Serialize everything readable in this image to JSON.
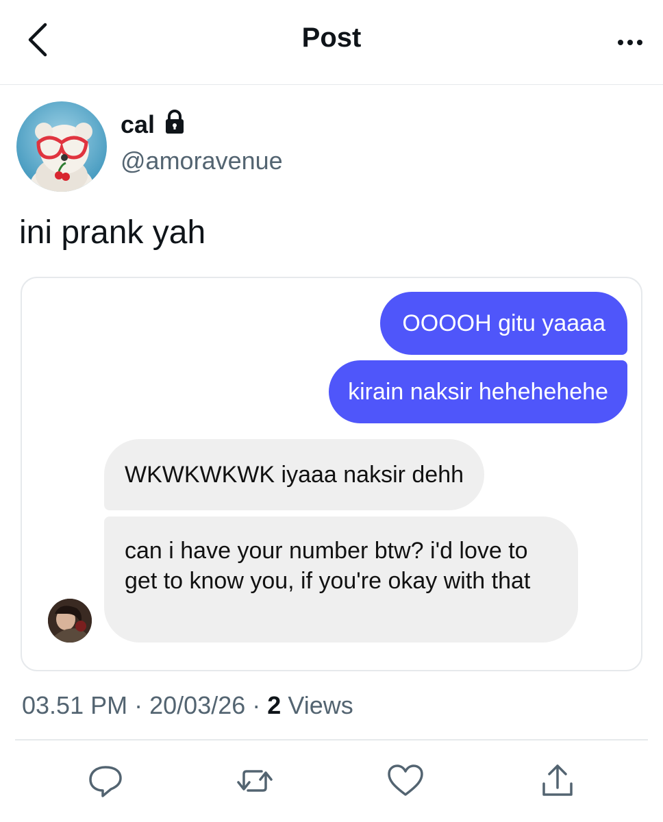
{
  "header": {
    "title": "Post"
  },
  "author": {
    "name": "cal",
    "handle": "@amoravenue"
  },
  "post": {
    "text": "ini prank yah",
    "timestamp_time": "03.51 PM",
    "timestamp_date": "20/03/26",
    "separator": "·",
    "views_count": "2",
    "views_label": "Views"
  },
  "chat": {
    "messages": [
      {
        "text": "OOOOH gitu yaaaa"
      },
      {
        "text": "kirain naksir hehehehehe"
      },
      {
        "text": "WKWKWKWK iyaaa naksir dehh"
      },
      {
        "text": "can i have your number btw? i'd love to get to know you, if you're okay with that"
      }
    ],
    "outgoing_color": "#4f56fa",
    "incoming_color": "#efefef"
  },
  "icons": {
    "back": "chevron-left-icon",
    "more": "more-horizontal-icon",
    "lock": "lock-icon",
    "reply": "reply-icon",
    "repost": "repost-icon",
    "like": "heart-icon",
    "share": "share-icon"
  }
}
